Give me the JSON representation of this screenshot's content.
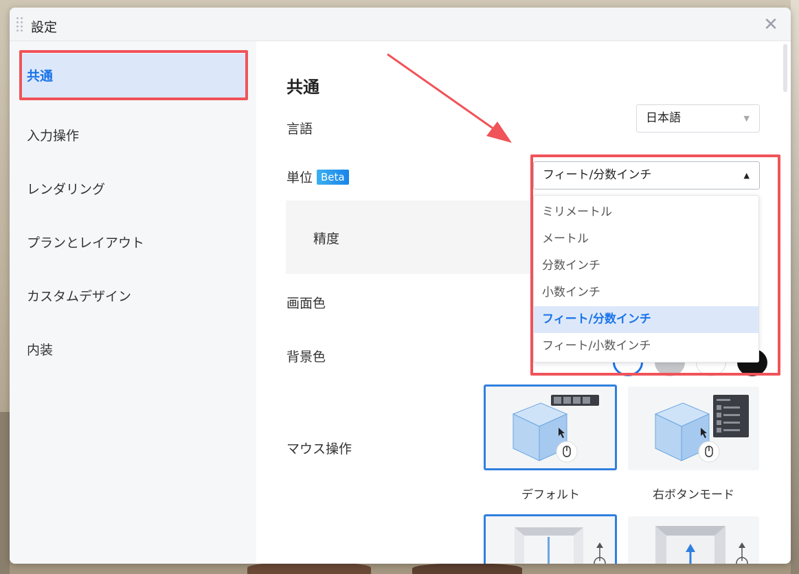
{
  "dialog": {
    "title": "設定",
    "close_glyph": "✕"
  },
  "sidebar": {
    "items": [
      {
        "label": "共通",
        "active": true
      },
      {
        "label": "入力操作"
      },
      {
        "label": "レンダリング"
      },
      {
        "label": "プランとレイアウト"
      },
      {
        "label": "カスタムデザイン"
      },
      {
        "label": "内装"
      }
    ]
  },
  "main": {
    "section_title": "共通",
    "language": {
      "label": "言語",
      "value": "日本語"
    },
    "unit": {
      "label": "単位",
      "badge": "Beta",
      "value": "フィート/分数インチ",
      "options": [
        "ミリメートル",
        "メートル",
        "分数インチ",
        "小数インチ",
        "フィート/分数インチ",
        "フィート/小数インチ"
      ],
      "selected_index": 4
    },
    "precision_label": "精度",
    "screen_color_label": "画面色",
    "background_color_label": "背景色",
    "background_colors": [
      "#ffffff",
      "#c4c6ca",
      "#ffffff",
      "#111111"
    ],
    "mouse_label": "マウス操作",
    "mouse_modes": [
      {
        "label": "デフォルト",
        "selected": true
      },
      {
        "label": "右ボタンモード",
        "selected": false
      }
    ]
  },
  "colors": {
    "accent": "#1a73e8",
    "highlight": "#f05359",
    "active_bg": "#dce8fa"
  }
}
